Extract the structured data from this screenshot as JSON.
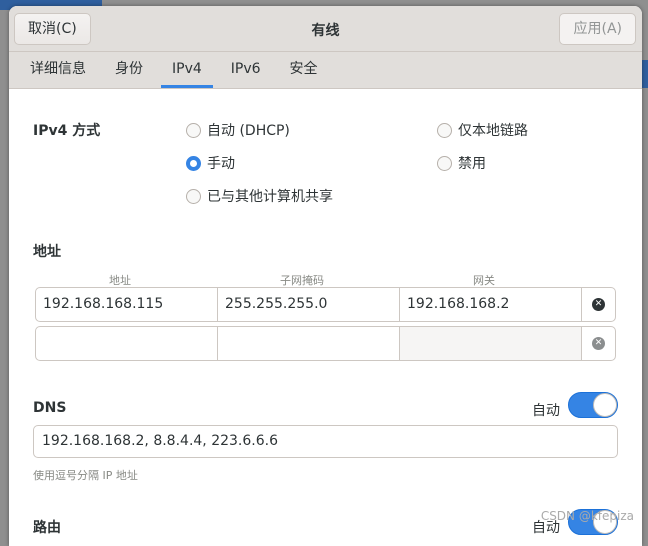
{
  "header": {
    "cancel": "取消(C)",
    "title": "有线",
    "apply": "应用(A)"
  },
  "tabs": [
    {
      "label": "详细信息"
    },
    {
      "label": "身份"
    },
    {
      "label": "IPv4",
      "active": true
    },
    {
      "label": "IPv6"
    },
    {
      "label": "安全"
    }
  ],
  "ipv4": {
    "method_label": "IPv4 方式",
    "options": {
      "dhcp": "自动 (DHCP)",
      "link_local": "仅本地链路",
      "manual": "手动",
      "disabled": "禁用",
      "shared": "已与其他计算机共享"
    },
    "selected": "manual"
  },
  "address": {
    "section": "地址",
    "headers": [
      "地址",
      "子网掩码",
      "网关"
    ],
    "rows": [
      [
        "192.168.168.115",
        "255.255.255.0",
        "192.168.168.2"
      ],
      [
        "",
        "",
        ""
      ]
    ]
  },
  "dns": {
    "label": "DNS",
    "auto_label": "自动",
    "auto": true,
    "value": "192.168.168.2, 8.8.4.4, 223.6.6.6",
    "hint": "使用逗号分隔 IP 地址"
  },
  "routes": {
    "label": "路由",
    "auto_label": "自动",
    "auto": true
  },
  "watermark": "CSDN @kfepiza",
  "colors": {
    "accent": "#3584e4"
  }
}
